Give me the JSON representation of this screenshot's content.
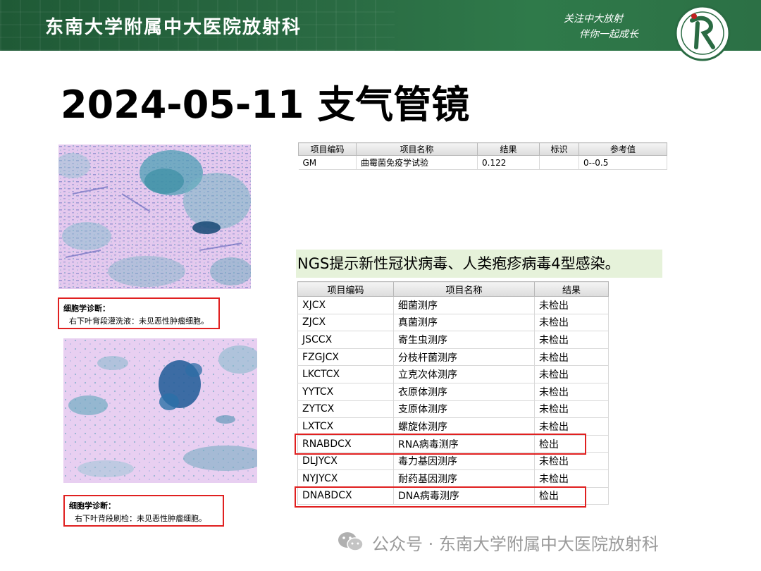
{
  "header": {
    "title": "东南大学附属中大医院放射科",
    "slogan_line1": "关注中大放射",
    "slogan_line2": "伴你一起成长",
    "brand_color": "#2a6b43"
  },
  "page_title": "2024-05-11 支气管镜",
  "cytology": [
    {
      "title": "细胞学诊断：",
      "body": "右下叶背段灌洗液：未见恶性肿瘤细胞。"
    },
    {
      "title": "细胞学诊断：",
      "body": "右下叶背段刷检：未见恶性肿瘤细胞。"
    }
  ],
  "gm_table": {
    "headers": [
      "项目编码",
      "项目名称",
      "结果",
      "标识",
      "参考值"
    ],
    "rows": [
      [
        "GM",
        "曲霉菌免疫学试验",
        "0.122",
        "",
        "0--0.5"
      ]
    ]
  },
  "ngs_banner": "NGS提示新性冠状病毒、人类疱疹病毒4型感染。",
  "ngs_table": {
    "headers": [
      "项目编码",
      "项目名称",
      "结果"
    ],
    "rows": [
      [
        "XJCX",
        "细菌测序",
        "未检出"
      ],
      [
        "ZJCX",
        "真菌测序",
        "未检出"
      ],
      [
        "JSCCX",
        "寄生虫测序",
        "未检出"
      ],
      [
        "FZGJCX",
        "分枝杆菌测序",
        "未检出"
      ],
      [
        "LKCTCX",
        "立克次体测序",
        "未检出"
      ],
      [
        "YYTCX",
        "衣原体测序",
        "未检出"
      ],
      [
        "ZYTCX",
        "支原体测序",
        "未检出"
      ],
      [
        "LXTCX",
        "螺旋体测序",
        "未检出"
      ],
      [
        "RNABDCX",
        "RNA病毒测序",
        "检出"
      ],
      [
        "DLJYCX",
        "毒力基因测序",
        "未检出"
      ],
      [
        "NYJYCX",
        "耐药基因测序",
        "未检出"
      ],
      [
        "DNABDCX",
        "DNA病毒测序",
        "检出"
      ]
    ]
  },
  "watermark": "公众号 · 东南大学附属中大医院放射科",
  "colors": {
    "highlight": "#e02020",
    "banner_bg": "#e6f2da",
    "stain_blue": "#3a8fa8",
    "stain_pink": "#e7c8ef"
  }
}
